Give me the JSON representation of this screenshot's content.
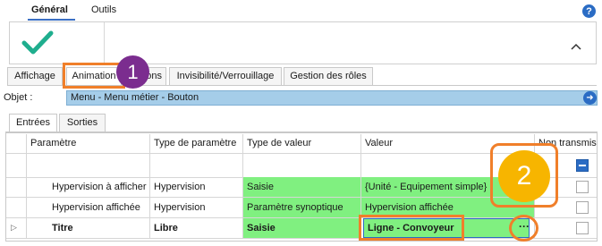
{
  "ribbon": {
    "tabs": [
      {
        "label": "Général",
        "active": true
      },
      {
        "label": "Outils",
        "active": false
      }
    ],
    "help_glyph": "?",
    "icons": {
      "validate": "checkmark-icon",
      "collapse": "chevron-up-icon",
      "help": "help-icon"
    }
  },
  "property_tabs": [
    {
      "label": "Affichage",
      "active": false
    },
    {
      "label": "Animation",
      "active": true
    },
    {
      "label": "ons",
      "active": false
    },
    {
      "label": "Invisibilité/Verrouillage",
      "active": false
    },
    {
      "label": "Gestion des rôles",
      "active": false
    }
  ],
  "annotations": {
    "step1": "1",
    "step2": "2",
    "color_orange": "#f07f2a",
    "color_purple": "#7b2d8f",
    "color_yellow": "#f7b500"
  },
  "objet": {
    "label": "Objet :",
    "value": "Menu - Menu métier - Bouton",
    "arrow_glyph": "➜"
  },
  "sub_tabs": [
    {
      "label": "Entrées",
      "active": true
    },
    {
      "label": "Sorties",
      "active": false
    }
  ],
  "grid": {
    "columns": [
      "Paramètre",
      "Type de paramètre",
      "Type de valeur",
      "Valeur",
      "Non transmis"
    ],
    "rows": [
      {
        "parametre": "Hypervision à afficher",
        "type_parametre": "Hypervision",
        "type_valeur": "Saisie",
        "valeur": "{Unité - Equipement simple}",
        "non_transmis": false
      },
      {
        "parametre": "Hypervision affichée",
        "type_parametre": "Hypervision",
        "type_valeur": "Paramètre synoptique",
        "valeur": "Hypervision affichée",
        "non_transmis": false
      },
      {
        "parametre": "Titre",
        "type_parametre": "Libre",
        "type_valeur": "Saisie",
        "valeur": "Ligne - Convoyeur",
        "non_transmis": false,
        "current": true
      }
    ],
    "ellipsis": "···",
    "row_indicator": "▷",
    "green": "#80f080"
  }
}
